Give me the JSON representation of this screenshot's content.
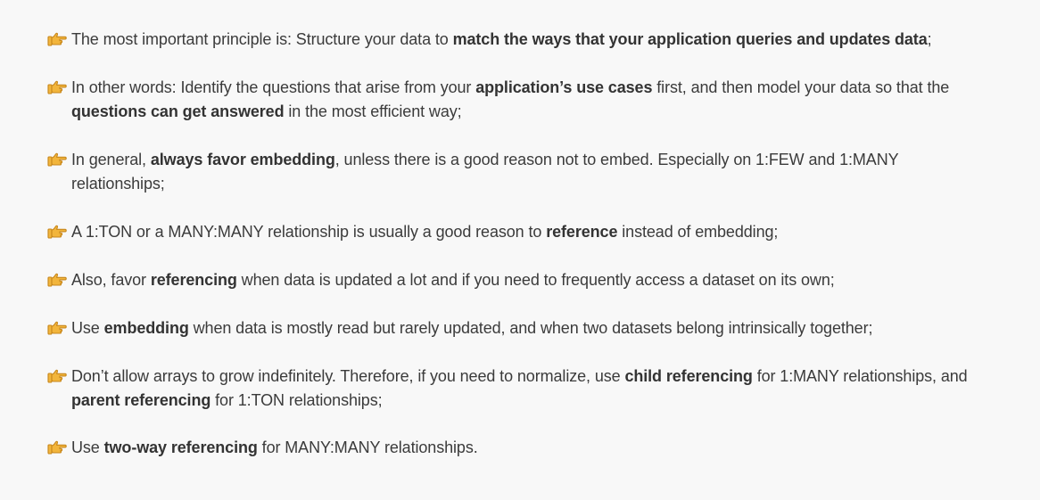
{
  "colors": {
    "background": "#f8f8f8",
    "text": "#3b3b3b",
    "icon_fill": "#f2b53c",
    "icon_stroke": "#c7861b"
  },
  "bullet_icon": "pointing-hand-icon",
  "items": [
    [
      {
        "t": "The most important principle is: Structure your data to ",
        "b": false
      },
      {
        "t": "match the ways that your application queries and updates data",
        "b": true
      },
      {
        "t": ";",
        "b": false
      }
    ],
    [
      {
        "t": "In other words: Identify the questions that arise from your ",
        "b": false
      },
      {
        "t": "application’s use cases",
        "b": true
      },
      {
        "t": " first, and then model your data so that the ",
        "b": false
      },
      {
        "t": "questions can get answered",
        "b": true
      },
      {
        "t": " in the most efficient way;",
        "b": false
      }
    ],
    [
      {
        "t": "In general, ",
        "b": false
      },
      {
        "t": "always favor embedding",
        "b": true
      },
      {
        "t": ", unless there is a good reason not to embed. Especially on 1:FEW and 1:MANY relationships;",
        "b": false
      }
    ],
    [
      {
        "t": "A 1:TON or a MANY:MANY relationship is usually a good reason to ",
        "b": false
      },
      {
        "t": "reference",
        "b": true
      },
      {
        "t": " instead of embedding;",
        "b": false
      }
    ],
    [
      {
        "t": "Also, favor ",
        "b": false
      },
      {
        "t": "referencing",
        "b": true
      },
      {
        "t": " when data is updated a lot and if you need to frequently access a dataset on its own;",
        "b": false
      }
    ],
    [
      {
        "t": "Use ",
        "b": false
      },
      {
        "t": "embedding",
        "b": true
      },
      {
        "t": " when data is mostly read but rarely updated, and when two datasets belong intrinsically together;",
        "b": false
      }
    ],
    [
      {
        "t": "Don’t allow arrays to grow indefinitely. Therefore, if you need to normalize, use ",
        "b": false
      },
      {
        "t": "child referencing",
        "b": true
      },
      {
        "t": " for 1:MANY relationships, and ",
        "b": false
      },
      {
        "t": "parent referencing",
        "b": true
      },
      {
        "t": " for 1:TON relationships;",
        "b": false
      }
    ],
    [
      {
        "t": "Use ",
        "b": false
      },
      {
        "t": "two-way referencing",
        "b": true
      },
      {
        "t": " for MANY:MANY relationships.",
        "b": false
      }
    ]
  ]
}
